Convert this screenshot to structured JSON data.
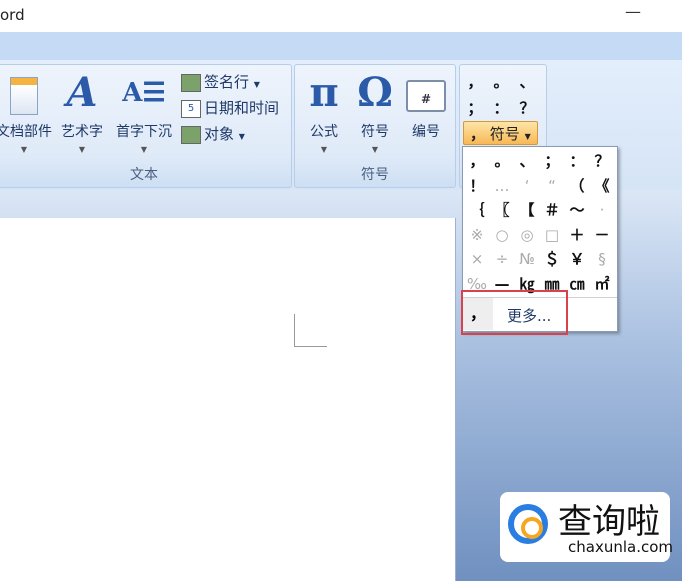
{
  "window": {
    "title": "ord",
    "minimize": "—"
  },
  "ribbon": {
    "groups": [
      {
        "label": "文本",
        "buttons": [
          {
            "label": "文档部件",
            "icon": "quick-parts-icon"
          },
          {
            "label": "艺术字",
            "icon": "wordart-icon",
            "glyph": "A"
          },
          {
            "label": "首字下沉",
            "icon": "drop-cap-icon",
            "glyph": "A☰"
          }
        ],
        "small": [
          {
            "label": "签名行",
            "icon": "signature-line-icon"
          },
          {
            "label": "日期和时间",
            "icon": "date-time-icon"
          },
          {
            "label": "对象",
            "icon": "object-icon"
          }
        ]
      },
      {
        "label": "符号",
        "buttons": [
          {
            "label": "公式",
            "glyph": "π"
          },
          {
            "label": "符号",
            "glyph": "Ω"
          },
          {
            "label": "编号",
            "glyph": "#"
          }
        ]
      }
    ],
    "quick_symbols": [
      "，",
      "。",
      "、",
      "；",
      "：",
      "？"
    ],
    "symbol_button": {
      "icon": "，",
      "label": "符号"
    }
  },
  "symbol_menu": {
    "symbols": [
      "，",
      "。",
      "、",
      "；",
      "：",
      "？",
      "！",
      "…",
      "‘",
      "“",
      "（",
      "《",
      "｛",
      "〖",
      "【",
      "＃",
      "～",
      "·",
      "※",
      "○",
      "◎",
      "□",
      "＋",
      "－",
      "×",
      "÷",
      "№",
      "＄",
      "￥",
      "§",
      "‰",
      "—",
      "㎏",
      "㎜",
      "㎝",
      "㎡"
    ],
    "more": {
      "icon": "，",
      "label": "更多..."
    }
  },
  "watermark": {
    "cn": "查询啦",
    "en": "chaxunla.com"
  }
}
